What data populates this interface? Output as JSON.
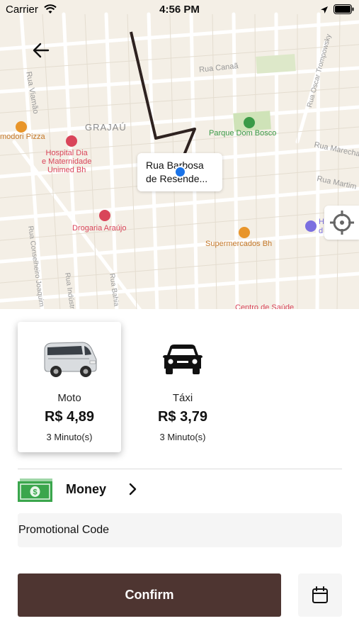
{
  "status_bar": {
    "carrier": "Carrier",
    "time": "4:56 PM"
  },
  "map": {
    "labels": {
      "grajau": "GRAJAÚ",
      "pizza": "modori Pizza",
      "hospital": "Hospital Dia\ne Maternidade\nUnimed Bh",
      "parque": "Parque Dom Bosco",
      "drogaria": "Drogaria Araújo",
      "supermercados": "Supermercados Bh",
      "rua_canaa": "Rua Canaã",
      "rua_viamao": "Rua Viamão",
      "rua_oscar": "Rua Oscar Trompowsky",
      "rua_marecha": "Rua Marecha",
      "rua_martim": "Rua Martim",
      "rua_conselheiro": "Rua Conselheiro Joaquim",
      "rua_industria": "Rua Indústria",
      "rua_bahia": "Rua Bahia",
      "centro": "Centro de Saúde",
      "edge_h": "H",
      "edge_d": "d"
    },
    "callout": {
      "line1": "Rua Barbosa",
      "line2": "de Resende..."
    }
  },
  "rides": [
    {
      "name": "Moto",
      "price": "R$ 4,89",
      "eta": "3 Minuto(s)",
      "icon": "van-icon",
      "selected": true
    },
    {
      "name": "Táxi",
      "price": "R$ 3,79",
      "eta": "3 Minuto(s)",
      "icon": "car-icon",
      "selected": false
    }
  ],
  "payment": {
    "label": "Money",
    "icon": "cash-icon"
  },
  "promo": {
    "placeholder": "Promotional Code"
  },
  "confirm": {
    "label": "Confirm"
  },
  "colors": {
    "confirm_bg": "#4e3531",
    "pin": "#1a73e8",
    "park_green": "#3a9a47",
    "poi_red": "#d9455a",
    "poi_orange": "#e8952a"
  }
}
